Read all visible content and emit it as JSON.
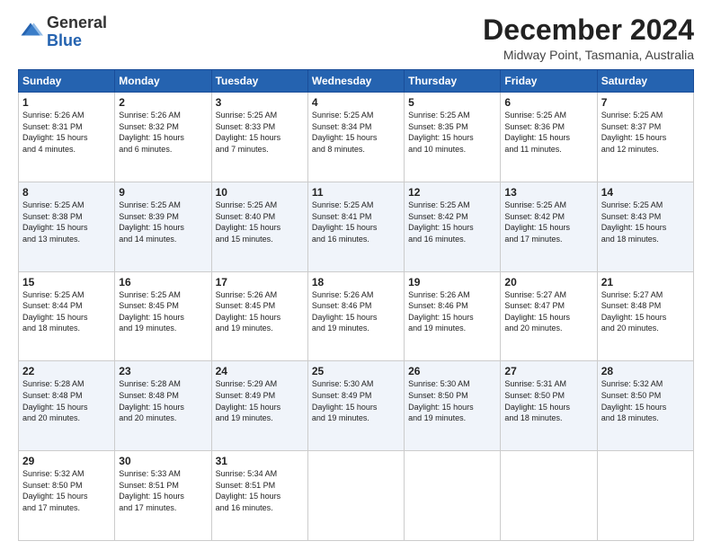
{
  "logo": {
    "general": "General",
    "blue": "Blue"
  },
  "header": {
    "month": "December 2024",
    "location": "Midway Point, Tasmania, Australia"
  },
  "days_of_week": [
    "Sunday",
    "Monday",
    "Tuesday",
    "Wednesday",
    "Thursday",
    "Friday",
    "Saturday"
  ],
  "weeks": [
    [
      {
        "day": "1",
        "sunrise": "5:26 AM",
        "sunset": "8:31 PM",
        "daylight": "15 hours and 4 minutes."
      },
      {
        "day": "2",
        "sunrise": "5:26 AM",
        "sunset": "8:32 PM",
        "daylight": "15 hours and 6 minutes."
      },
      {
        "day": "3",
        "sunrise": "5:25 AM",
        "sunset": "8:33 PM",
        "daylight": "15 hours and 7 minutes."
      },
      {
        "day": "4",
        "sunrise": "5:25 AM",
        "sunset": "8:34 PM",
        "daylight": "15 hours and 8 minutes."
      },
      {
        "day": "5",
        "sunrise": "5:25 AM",
        "sunset": "8:35 PM",
        "daylight": "15 hours and 10 minutes."
      },
      {
        "day": "6",
        "sunrise": "5:25 AM",
        "sunset": "8:36 PM",
        "daylight": "15 hours and 11 minutes."
      },
      {
        "day": "7",
        "sunrise": "5:25 AM",
        "sunset": "8:37 PM",
        "daylight": "15 hours and 12 minutes."
      }
    ],
    [
      {
        "day": "8",
        "sunrise": "5:25 AM",
        "sunset": "8:38 PM",
        "daylight": "15 hours and 13 minutes."
      },
      {
        "day": "9",
        "sunrise": "5:25 AM",
        "sunset": "8:39 PM",
        "daylight": "15 hours and 14 minutes."
      },
      {
        "day": "10",
        "sunrise": "5:25 AM",
        "sunset": "8:40 PM",
        "daylight": "15 hours and 15 minutes."
      },
      {
        "day": "11",
        "sunrise": "5:25 AM",
        "sunset": "8:41 PM",
        "daylight": "15 hours and 16 minutes."
      },
      {
        "day": "12",
        "sunrise": "5:25 AM",
        "sunset": "8:42 PM",
        "daylight": "15 hours and 16 minutes."
      },
      {
        "day": "13",
        "sunrise": "5:25 AM",
        "sunset": "8:42 PM",
        "daylight": "15 hours and 17 minutes."
      },
      {
        "day": "14",
        "sunrise": "5:25 AM",
        "sunset": "8:43 PM",
        "daylight": "15 hours and 18 minutes."
      }
    ],
    [
      {
        "day": "15",
        "sunrise": "5:25 AM",
        "sunset": "8:44 PM",
        "daylight": "15 hours and 18 minutes."
      },
      {
        "day": "16",
        "sunrise": "5:25 AM",
        "sunset": "8:45 PM",
        "daylight": "15 hours and 19 minutes."
      },
      {
        "day": "17",
        "sunrise": "5:26 AM",
        "sunset": "8:45 PM",
        "daylight": "15 hours and 19 minutes."
      },
      {
        "day": "18",
        "sunrise": "5:26 AM",
        "sunset": "8:46 PM",
        "daylight": "15 hours and 19 minutes."
      },
      {
        "day": "19",
        "sunrise": "5:26 AM",
        "sunset": "8:46 PM",
        "daylight": "15 hours and 19 minutes."
      },
      {
        "day": "20",
        "sunrise": "5:27 AM",
        "sunset": "8:47 PM",
        "daylight": "15 hours and 20 minutes."
      },
      {
        "day": "21",
        "sunrise": "5:27 AM",
        "sunset": "8:48 PM",
        "daylight": "15 hours and 20 minutes."
      }
    ],
    [
      {
        "day": "22",
        "sunrise": "5:28 AM",
        "sunset": "8:48 PM",
        "daylight": "15 hours and 20 minutes."
      },
      {
        "day": "23",
        "sunrise": "5:28 AM",
        "sunset": "8:48 PM",
        "daylight": "15 hours and 20 minutes."
      },
      {
        "day": "24",
        "sunrise": "5:29 AM",
        "sunset": "8:49 PM",
        "daylight": "15 hours and 19 minutes."
      },
      {
        "day": "25",
        "sunrise": "5:30 AM",
        "sunset": "8:49 PM",
        "daylight": "15 hours and 19 minutes."
      },
      {
        "day": "26",
        "sunrise": "5:30 AM",
        "sunset": "8:50 PM",
        "daylight": "15 hours and 19 minutes."
      },
      {
        "day": "27",
        "sunrise": "5:31 AM",
        "sunset": "8:50 PM",
        "daylight": "15 hours and 18 minutes."
      },
      {
        "day": "28",
        "sunrise": "5:32 AM",
        "sunset": "8:50 PM",
        "daylight": "15 hours and 18 minutes."
      }
    ],
    [
      {
        "day": "29",
        "sunrise": "5:32 AM",
        "sunset": "8:50 PM",
        "daylight": "15 hours and 17 minutes."
      },
      {
        "day": "30",
        "sunrise": "5:33 AM",
        "sunset": "8:51 PM",
        "daylight": "15 hours and 17 minutes."
      },
      {
        "day": "31",
        "sunrise": "5:34 AM",
        "sunset": "8:51 PM",
        "daylight": "15 hours and 16 minutes."
      },
      null,
      null,
      null,
      null
    ]
  ],
  "labels": {
    "sunrise": "Sunrise:",
    "sunset": "Sunset:",
    "daylight": "Daylight:"
  }
}
